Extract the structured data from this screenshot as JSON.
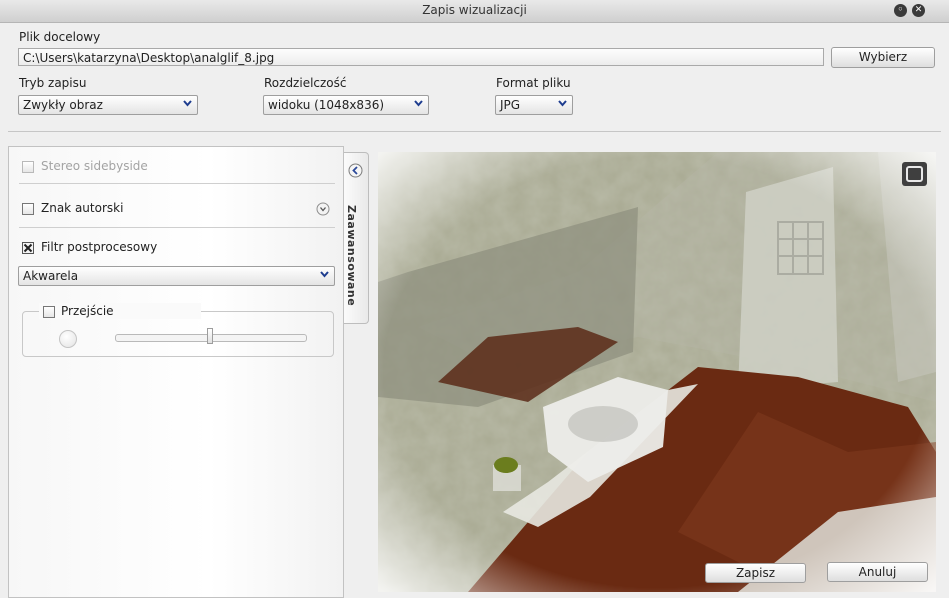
{
  "window": {
    "title": "Zapis wizualizacji"
  },
  "target_file": {
    "label": "Plik docelowy",
    "path": "C:\\Users\\katarzyna\\Desktop\\analglif_8.jpg",
    "choose_button": "Wybierz"
  },
  "save_mode": {
    "label": "Tryb zapisu",
    "value": "Zwykły obraz"
  },
  "resolution": {
    "label": "Rozdzielczość",
    "value": "widoku (1048x836)"
  },
  "file_format": {
    "label": "Format pliku",
    "value": "JPG"
  },
  "advanced": {
    "tab_label": "Zaawansowane",
    "stereo_label": "Stereo sidebyside",
    "watermark_label": "Znak autorski",
    "postprocess_label": "Filtr postprocesowy",
    "postprocess_checked": true,
    "filter_value": "Akwarela",
    "transition_label": "Przejście",
    "transition_slider_value": 0.5
  },
  "actions": {
    "save": "Zapisz",
    "cancel": "Anuluj"
  },
  "colors": {
    "floor": "#6a2a12",
    "wall": "#a9aa93"
  }
}
